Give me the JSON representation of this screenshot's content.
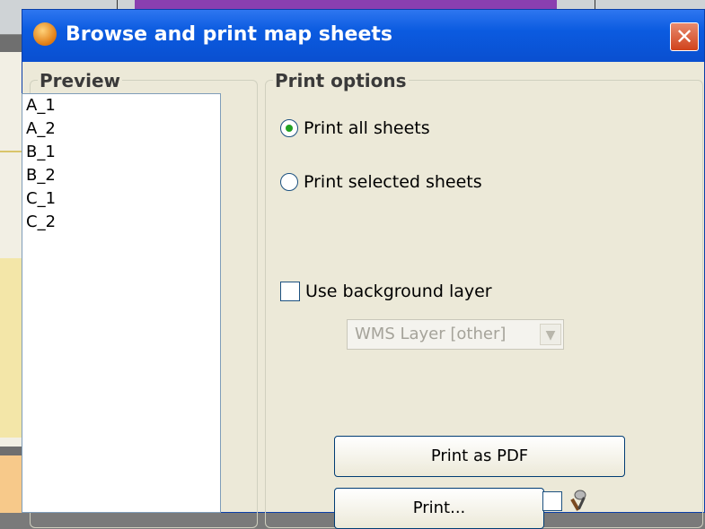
{
  "dialog": {
    "title": "Browse and print map sheets",
    "close_glyph": "✕"
  },
  "preview": {
    "legend": "Preview",
    "items": [
      "A_1",
      "A_2",
      "B_1",
      "B_2",
      "C_1",
      "C_2"
    ]
  },
  "print_options": {
    "legend": "Print options",
    "radio_all": {
      "label": "Print all sheets",
      "checked": true
    },
    "radio_selected": {
      "label": "Print selected sheets",
      "checked": false
    },
    "use_background": {
      "label": "Use background layer",
      "checked": false
    },
    "layer_select": {
      "value": "WMS Layer [other]",
      "disabled": true
    },
    "print_pdf_label": "Print as PDF",
    "print_label": "Print..."
  },
  "colors": {
    "titlebar": "#0b5be0",
    "dialog_bg": "#ece9d8",
    "radio_dot": "#21a121"
  }
}
